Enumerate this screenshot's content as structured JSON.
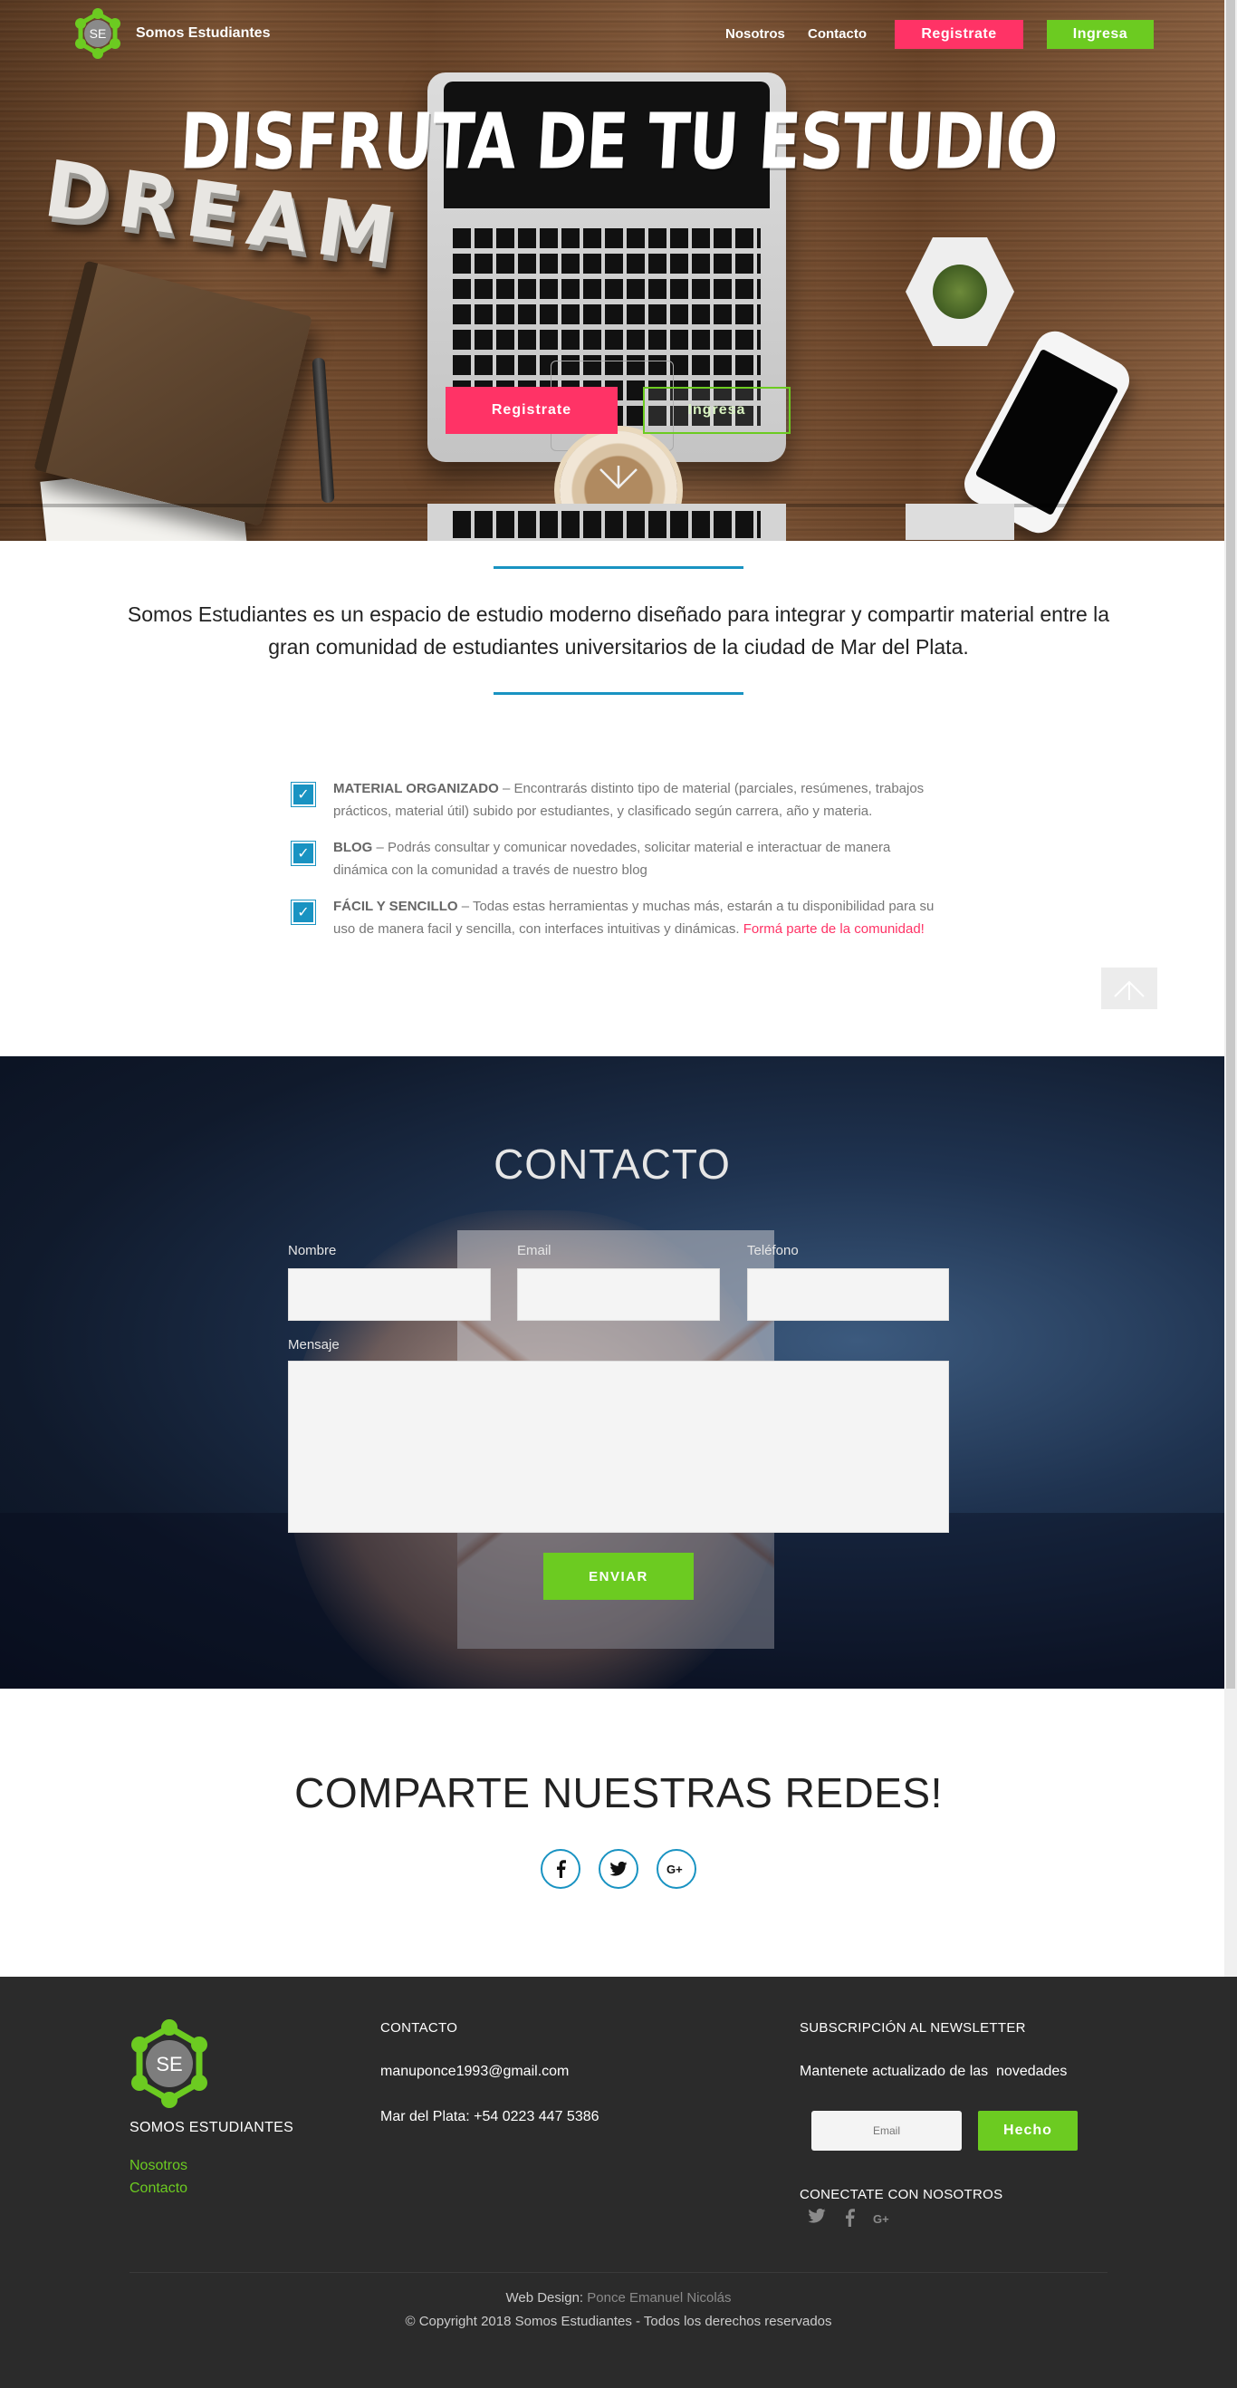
{
  "nav": {
    "logo_text": "SE",
    "brand": "Somos Estudiantes",
    "links": [
      "Nosotros",
      "Contacto"
    ],
    "register_label": "Registrate",
    "login_label": "Ingresa"
  },
  "hero": {
    "title": "DISFRUTA DE TU ESTUDIO",
    "photo_text": "DREAM",
    "register_label": "Registrate",
    "login_label": "Ingresa",
    "scroll_icon": "chevron-down-icon"
  },
  "intro": {
    "text": "Somos Estudiantes es un espacio de estudio moderno diseñado para integrar y compartir material entre la gran comunidad de estudiantes universitarios de la ciudad de Mar del Plata."
  },
  "features": [
    {
      "title": "MATERIAL ORGANIZADO",
      "text": " – Encontrarás distinto tipo de material (parciales, resúmenes, trabajos prácticos, material útil) subido por estudiantes, y clasificado según carrera, año y materia."
    },
    {
      "title": "BLOG",
      "text": " – Podrás consultar y comunicar novedades, solicitar material e interactuar de manera dinámica con la comunidad a través de nuestro blog"
    },
    {
      "title": "FÁCIL Y SENCILLO",
      "text": " – Todas estas herramientas y muchas más, estarán a tu disponibilidad para su uso de manera facil y sencilla, con interfaces intuitivas y dinámicas. ",
      "link": "Formá parte de la comunidad!"
    }
  ],
  "check_glyph": "✓",
  "contact": {
    "title": "CONTACTO",
    "name_label": "Nombre",
    "email_label": "Email",
    "phone_label": "Teléfono",
    "message_label": "Mensaje",
    "send_label": "ENVIAR"
  },
  "social": {
    "title": "COMPARTE NUESTRAS REDES!",
    "icons": [
      "facebook-icon",
      "twitter-icon",
      "google-plus-icon"
    ]
  },
  "footer": {
    "logo_text": "SE",
    "brand": "SOMOS ESTUDIANTES",
    "links": [
      "Nosotros",
      "Contacto"
    ],
    "contact_heading": "CONTACTO",
    "email": "manuponce1993@gmail.com",
    "phone": "Mar del Plata: +54 0223 447 5386",
    "newsletter_heading": "SUBSCRIPCIÓN AL NEWSLETTER",
    "newsletter_text": "Mantenete actualizado de las  novedades",
    "email_placeholder": "Email",
    "subscribe_label": "Hecho",
    "connect_heading": "CONECTATE CON NOSOTROS",
    "social_icons": [
      "twitter-icon",
      "facebook-icon",
      "google-plus-icon"
    ],
    "credit_prefix": "Web Design: ",
    "credit_name": "Ponce Emanuel Nicolás",
    "copyright": "© Copyright 2018 Somos Estudiantes - Todos los derechos reservados"
  },
  "colors": {
    "accent_pink": "#ff3366",
    "accent_green": "#6ccb21",
    "accent_blue": "#1993c2",
    "footer_bg": "#2b2b2b"
  }
}
